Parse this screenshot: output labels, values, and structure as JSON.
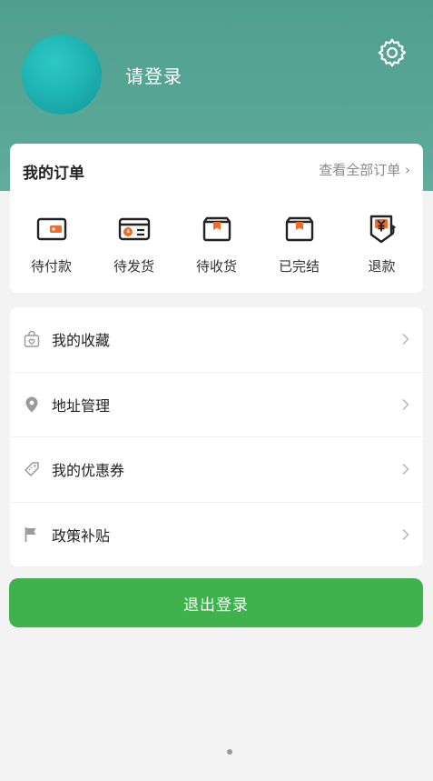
{
  "header": {
    "login_prompt": "请登录"
  },
  "orders": {
    "title": "我的订单",
    "view_all": "查看全部订单 ›",
    "items": [
      {
        "label": "待付款",
        "icon": "wallet-icon"
      },
      {
        "label": "待发货",
        "icon": "card-clock-icon"
      },
      {
        "label": "待收货",
        "icon": "box-icon"
      },
      {
        "label": "已完结",
        "icon": "box-icon"
      },
      {
        "label": "退款",
        "icon": "yen-refund-icon"
      }
    ]
  },
  "menu": {
    "items": [
      {
        "label": "我的收藏",
        "icon": "favorites-bag-icon"
      },
      {
        "label": "地址管理",
        "icon": "location-pin-icon"
      },
      {
        "label": "我的优惠券",
        "icon": "coupon-icon"
      },
      {
        "label": "政策补贴",
        "icon": "flag-icon"
      }
    ]
  },
  "logout_label": "退出登录",
  "colors": {
    "header": "#5aa797",
    "accent_orange": "#f26b2a",
    "logout_green": "#3fb24e"
  }
}
